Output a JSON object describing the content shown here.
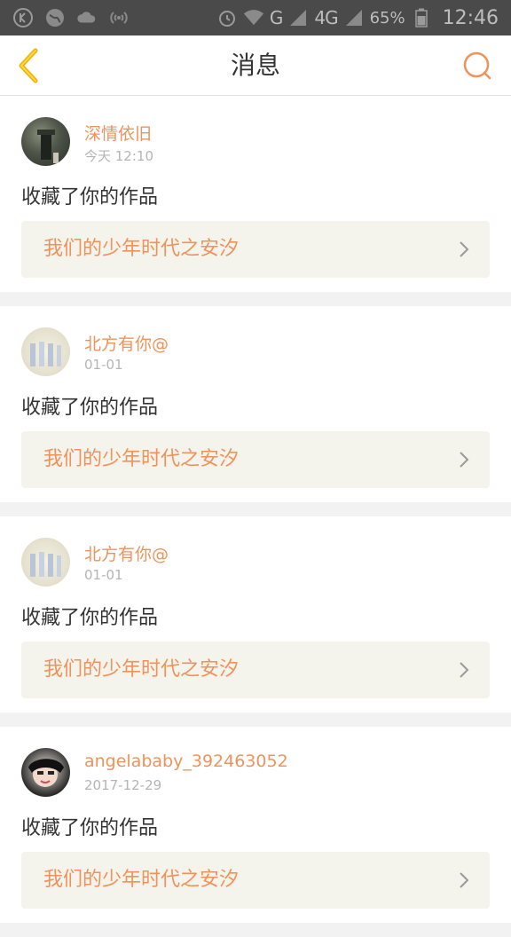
{
  "status_bar": {
    "network_3g": "G",
    "network_4g": "4G",
    "battery": "65%",
    "time": "12:46"
  },
  "header": {
    "title": "消息"
  },
  "colors": {
    "accent": "#f0935a",
    "back_icon": "#f0b400",
    "link_bg": "#f4f3ec"
  },
  "messages": [
    {
      "username": "深情依旧",
      "time": "今天 12:10",
      "action": "收藏了你的作品",
      "work_title": "我们的少年时代之安汐"
    },
    {
      "username": "北方有你@",
      "time": "01-01",
      "action": "收藏了你的作品",
      "work_title": "我们的少年时代之安汐"
    },
    {
      "username": "北方有你@",
      "time": "01-01",
      "action": "收藏了你的作品",
      "work_title": "我们的少年时代之安汐"
    },
    {
      "username": "angelababy_392463052",
      "time": "2017-12-29",
      "action": "收藏了你的作品",
      "work_title": "我们的少年时代之安汐"
    }
  ]
}
